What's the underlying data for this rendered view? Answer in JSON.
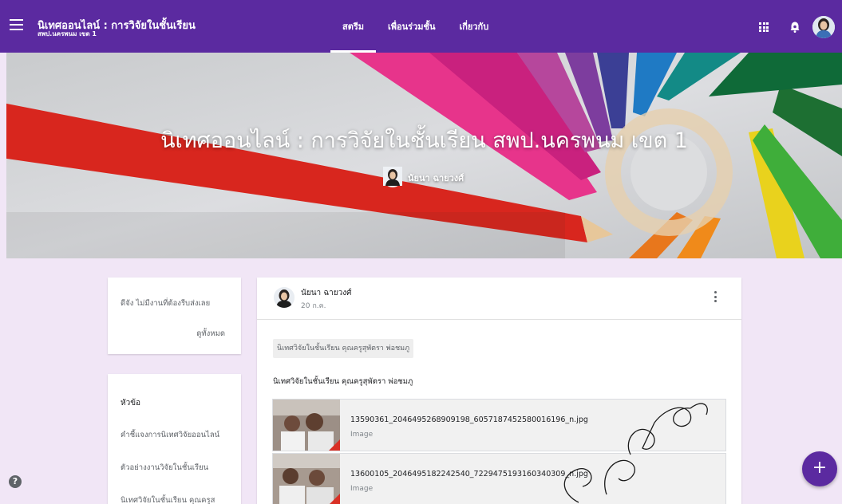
{
  "header": {
    "class_title": "นิเทศออนไลน์ : การวิจัยในชั้นเรียน",
    "class_subtitle": "สพป.นครพนม เขต 1",
    "tabs": [
      {
        "label": "สตรีม",
        "active": true
      },
      {
        "label": "เพื่อนร่วมชั้น",
        "active": false
      },
      {
        "label": "เกี่ยวกับ",
        "active": false
      }
    ],
    "icons": [
      "menu-icon",
      "apps-icon",
      "notification-icon",
      "account-avatar"
    ],
    "accent_color": "#5b2aa0"
  },
  "banner": {
    "title": "นิเทศออนไลน์ : การวิจัยในชั้นเรียน สพป.นครพนม เขต 1",
    "teacher": "นัยนา ฉายวงศ์"
  },
  "upcoming": {
    "message": "ดีจัง ไม่มีงานที่ต้องรีบส่งเลย",
    "view_all": "ดูทั้งหมด"
  },
  "topics": {
    "heading": "หัวข้อ",
    "items": [
      "คำชี้แจงการนิเทศวิจัยออนไลน์",
      "ตัวอย่างงานวิจัยในชั้นเรียน",
      "นิเทศวิจัยในชั้นเรียน คุณครูส"
    ]
  },
  "post": {
    "author": "นัยนา ฉายวงศ์",
    "date": "20 ก.ค.",
    "topic_chip": "นิเทศวิจัยในชั้นเรียน คุณครูสุพัตรา พ่อชมภู",
    "text": "นิเทศวิจัยในชั้นเรียน คุณครูสุพัตรา พ่อชมภู",
    "attachments": [
      {
        "filename": "13590361_2046495268909198_6057187452580016196_n.jpg",
        "type": "Image"
      },
      {
        "filename": "13600105_2046495182242540_7229475193160340309_n.jpg",
        "type": "Image"
      }
    ]
  },
  "fab_label": "+",
  "help_label": "?"
}
